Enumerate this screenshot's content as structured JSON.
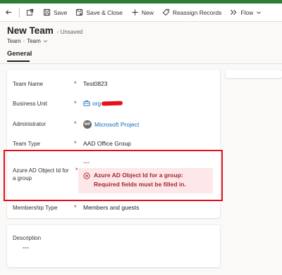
{
  "colors": {
    "brand_bar": "#2e7d32",
    "error": "#a4262c",
    "error_bg": "#fde7e9",
    "highlight": "#e0101a",
    "link": "#0f6cbd"
  },
  "commandbar": {
    "back_icon": "back-arrow-icon",
    "popout_icon": "popout-icon",
    "save_label": "Save",
    "save_close_label": "Save & Close",
    "new_label": "New",
    "reassign_label": "Reassign Records",
    "flow_label": "Flow"
  },
  "header": {
    "title": "New Team",
    "status": "- Unsaved",
    "entity": "Team",
    "separator": "·",
    "form": "Team"
  },
  "tabs": [
    {
      "label": "General",
      "selected": true
    }
  ],
  "form": {
    "team_name": {
      "label": "Team Name",
      "required": "*",
      "value": "Test0823"
    },
    "business_unit": {
      "label": "Business Unit",
      "required": "*",
      "value": "org"
    },
    "administrator": {
      "label": "Administrator",
      "required": "*",
      "initials": "MP",
      "value": "Microsoft Project"
    },
    "team_type": {
      "label": "Team Type",
      "required": "*",
      "value": "AAD Office Group"
    },
    "azure_id": {
      "label": "Azure AD Object Id for a group",
      "required": "*",
      "value": "---",
      "error": "Azure AD Object Id for a group: Required fields must be filled in."
    },
    "membership_type": {
      "label": "Membership Type",
      "required": "*",
      "value": "Members and guests"
    }
  },
  "description": {
    "label": "Description",
    "value": "---"
  }
}
